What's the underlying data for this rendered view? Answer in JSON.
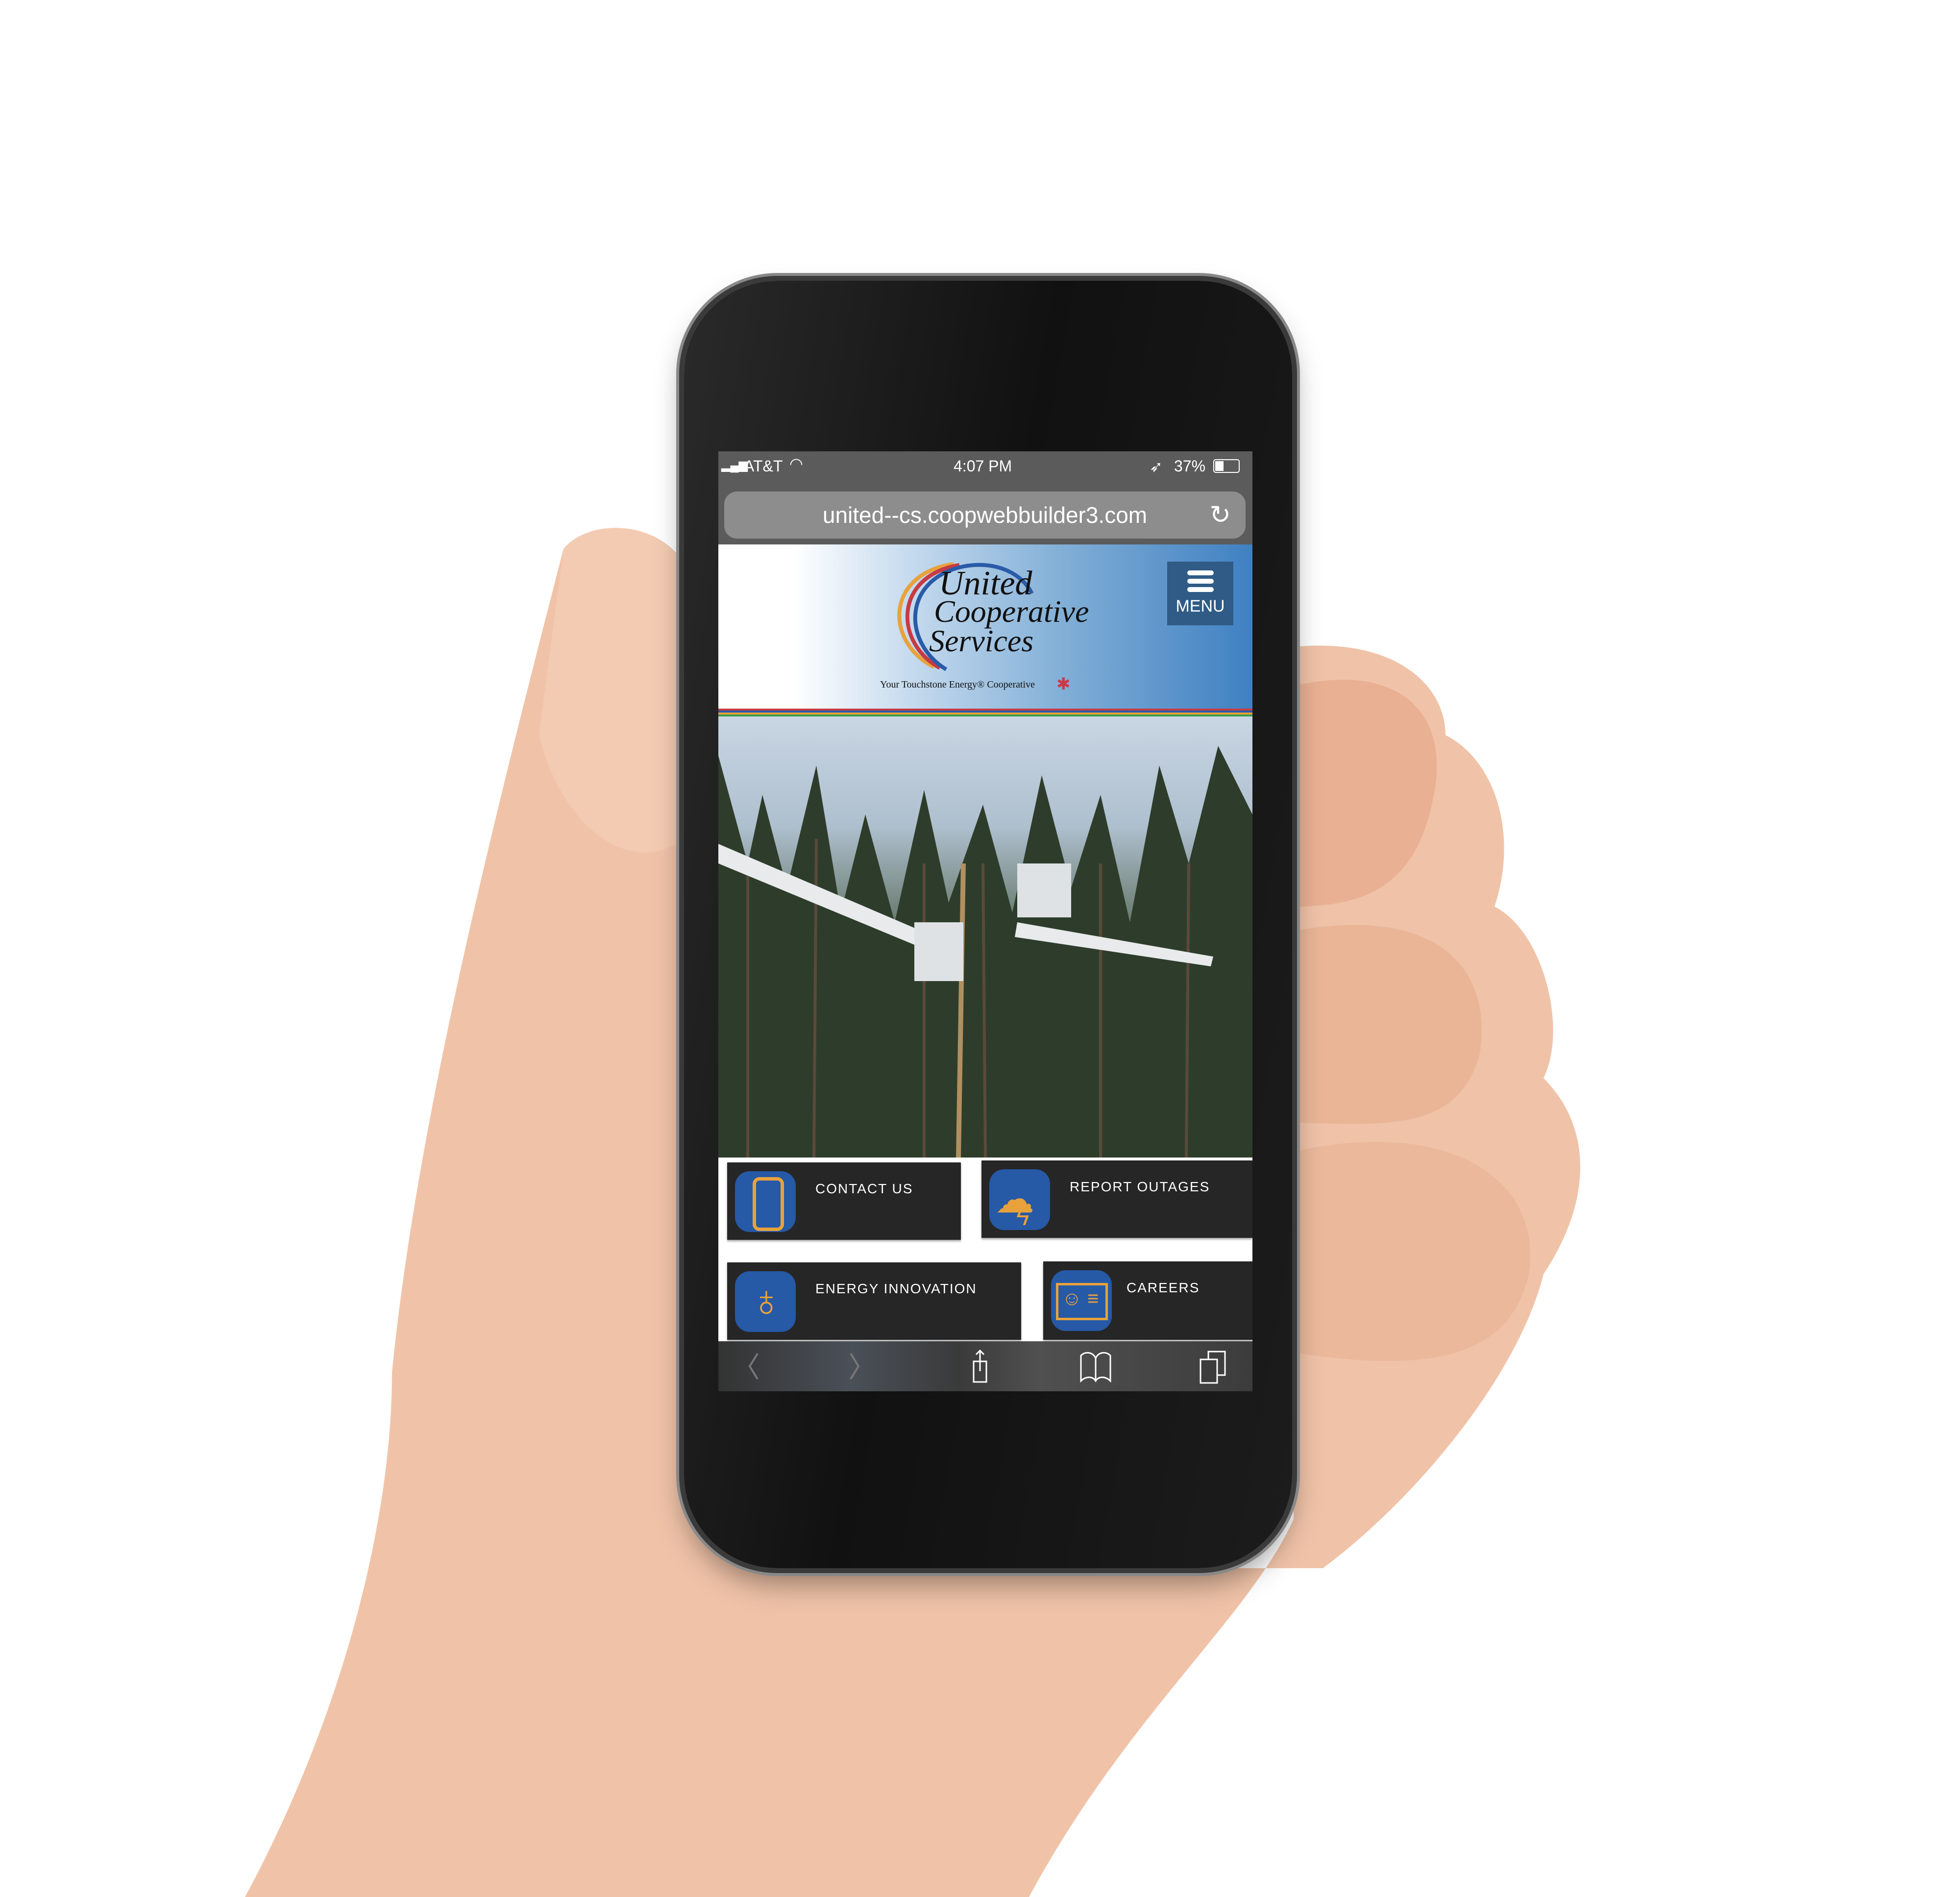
{
  "status_bar": {
    "carrier": "AT&T",
    "time": "4:07 PM",
    "battery": "37%",
    "battery_level": 0.37
  },
  "browser": {
    "url": "united--cs.coopwebbuilder3.com"
  },
  "header": {
    "logo_text": [
      "United",
      "Cooperative",
      "Services"
    ],
    "tagline": "Your Touchstone Energy® Cooperative",
    "menu_label": "MENU"
  },
  "tiles": [
    {
      "label": "CONTACT US",
      "icon": "smartphone-icon"
    },
    {
      "label": "REPORT OUTAGES",
      "icon": "storm-cloud-icon"
    },
    {
      "label": "ENERGY INNOVATION",
      "icon": "lightbulb-leaf-icon"
    },
    {
      "label": "CAREERS",
      "icon": "id-card-icon"
    }
  ],
  "colors": {
    "tile_bg": "#262626",
    "icon_blue": "#2659a6",
    "icon_orange": "#e8a23c",
    "menu_bg": "#2f5b86"
  }
}
